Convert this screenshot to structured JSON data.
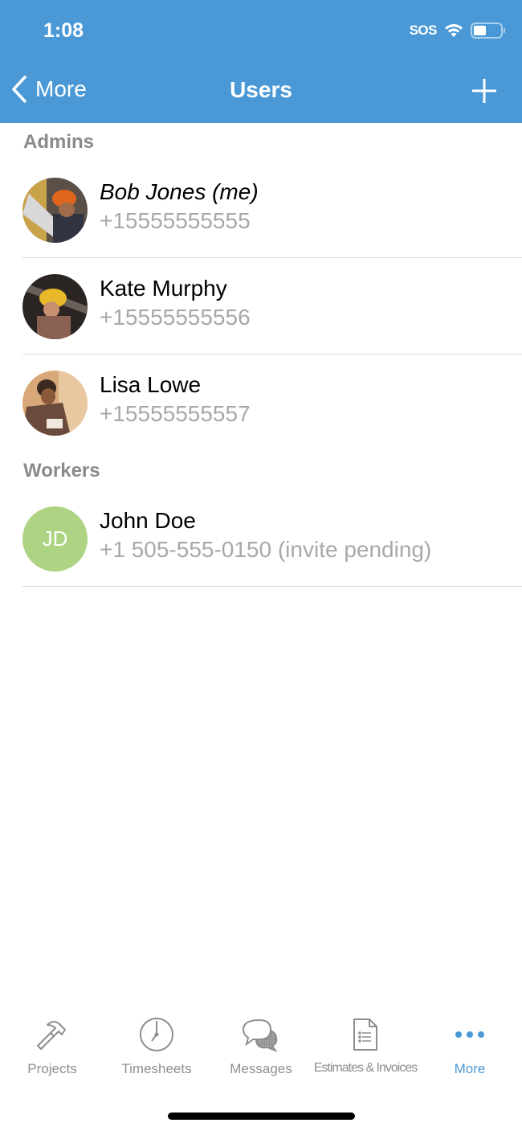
{
  "status_bar": {
    "time": "1:08",
    "carrier": "SOS",
    "icons": [
      "wifi-icon",
      "battery-icon"
    ]
  },
  "nav": {
    "back_label": "More",
    "title": "Users",
    "add_icon": "plus-icon"
  },
  "sections": [
    {
      "header": "Admins",
      "users": [
        {
          "name": "Bob Jones (me)",
          "phone": "+15555555555",
          "avatar": "photo",
          "is_me": true
        },
        {
          "name": "Kate Murphy",
          "phone": "+15555555556",
          "avatar": "photo"
        },
        {
          "name": "Lisa Lowe",
          "phone": "+15555555557",
          "avatar": "photo"
        }
      ]
    },
    {
      "header": "Workers",
      "users": [
        {
          "name": "John Doe",
          "phone": "+1 505-555-0150 (invite pending)",
          "avatar": "initials",
          "initials": "JD",
          "avatar_color": "#add383"
        }
      ]
    }
  ],
  "tabbar": {
    "tabs": [
      {
        "label": "Projects",
        "icon": "hammer-icon",
        "active": false
      },
      {
        "label": "Timesheets",
        "icon": "clock-icon",
        "active": false
      },
      {
        "label": "Messages",
        "icon": "chat-bubbles-icon",
        "active": false
      },
      {
        "label": "Estimates & Invoices",
        "icon": "document-icon",
        "active": false
      },
      {
        "label": "More",
        "icon": "more-dots-icon",
        "active": true
      }
    ]
  },
  "colors": {
    "brand": "#4a99d6",
    "secondary_text": "#a8a8a8",
    "section_header": "#8a8a8a"
  }
}
